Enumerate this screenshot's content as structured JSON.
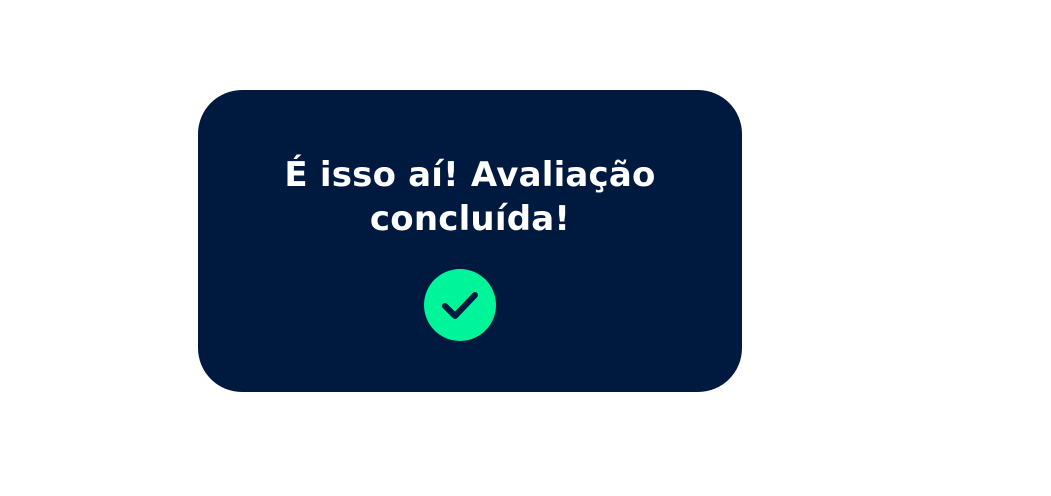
{
  "dialog": {
    "title_line_1": "É isso aí! Avaliação",
    "title_line_2": "concluída!",
    "icon": "check-icon"
  },
  "colors": {
    "card_background": "#001a3f",
    "title_text": "#ffffff",
    "check_badge": "#00f59b",
    "check_mark": "#001a3f"
  }
}
